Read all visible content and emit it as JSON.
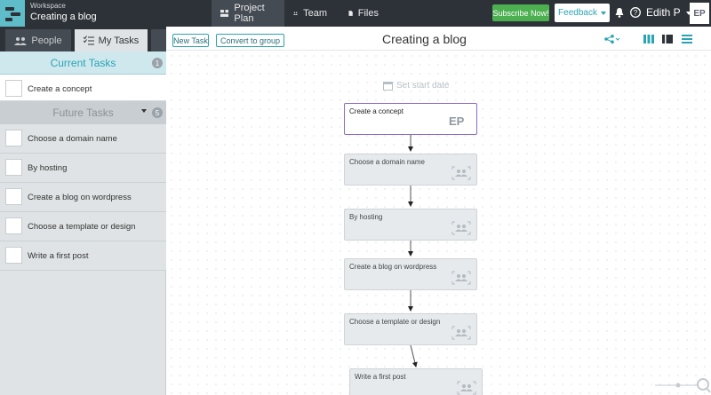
{
  "header": {
    "workspace_label": "Workspace",
    "workspace_name": "Creating a blog",
    "nav": [
      {
        "label": "Project Plan",
        "icon": "project-plan-icon",
        "active": true
      },
      {
        "label": "Team",
        "icon": "team-icon",
        "active": false
      },
      {
        "label": "Files",
        "icon": "files-icon",
        "active": false
      }
    ],
    "subscribe_label": "Subscribe Now!",
    "feedback_label": "Feedback",
    "user_name": "Edith P",
    "avatar_initials": "EP"
  },
  "sidebar": {
    "tabs": [
      {
        "label": "People",
        "icon": "people-icon"
      },
      {
        "label": "My Tasks",
        "icon": "checklist-icon"
      }
    ],
    "current": {
      "title": "Current Tasks",
      "count": "1",
      "tasks": [
        "Create a concept"
      ]
    },
    "future": {
      "title": "Future Tasks",
      "count": "5",
      "tasks": [
        "Choose a domain name",
        "By hosting",
        "Create a blog on wordpress",
        "Choose a template or design",
        "Write a first post"
      ]
    }
  },
  "main": {
    "new_task_label": "New Task",
    "convert_label": "Convert to group",
    "title": "Creating a blog",
    "set_start_date": "Set start date",
    "nodes": [
      {
        "label": "Create a concept",
        "assignee": "EP",
        "active": true
      },
      {
        "label": "Choose a domain name",
        "assignee": "",
        "active": false
      },
      {
        "label": "By hosting",
        "assignee": "",
        "active": false
      },
      {
        "label": "Create a blog on wordpress",
        "assignee": "",
        "active": false
      },
      {
        "label": "Choose a template or design",
        "assignee": "",
        "active": false
      },
      {
        "label": "Write a first post",
        "assignee": "",
        "active": false
      }
    ]
  },
  "colors": {
    "accent": "#2aa4b4",
    "topbar": "#2d3238",
    "subscribe": "#4caf50",
    "active_node_border": "#8c6bc4"
  }
}
